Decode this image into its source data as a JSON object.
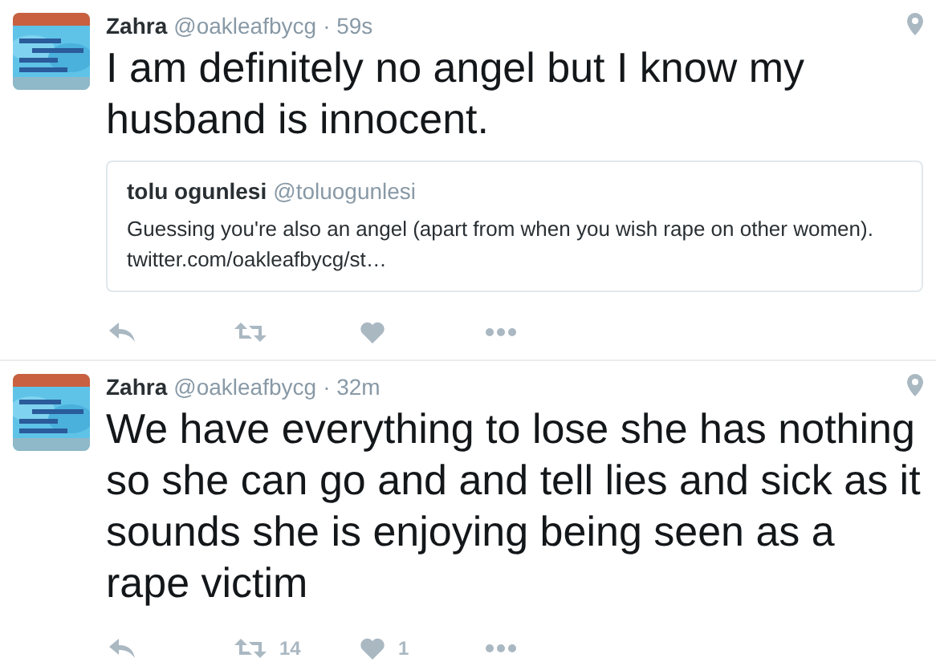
{
  "tweets": [
    {
      "name": "Zahra",
      "handle": "@oakleafbycg",
      "time": "· 59s",
      "text": "I am definitely no angel but I know my husband is innocent.",
      "quote": {
        "name": "tolu ogunlesi",
        "handle": "@toluogunlesi",
        "text": "Guessing you're also an angel (apart from when you wish rape on other women). twitter.com/oakleafbycg/st…"
      }
    },
    {
      "name": "Zahra",
      "handle": "@oakleafbycg",
      "time": "· 32m",
      "text": "We have everything to lose she has nothing so she can go and and tell lies and sick as it sounds she is enjoying being seen as a rape victim",
      "retweets": "14",
      "likes": "1"
    }
  ]
}
